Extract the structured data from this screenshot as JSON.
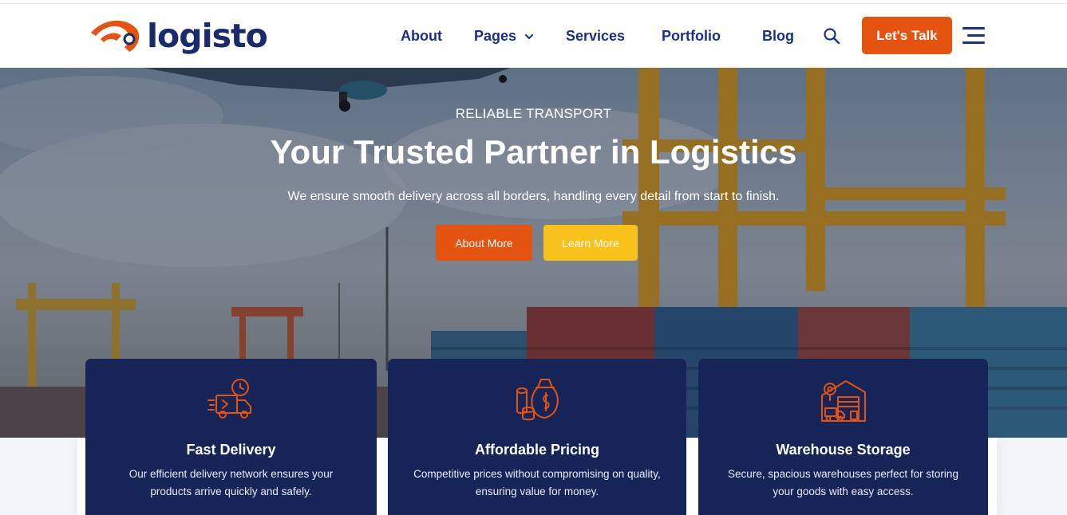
{
  "brand": {
    "name": "logisto",
    "logo_icon": "logo-mark-icon",
    "colors": {
      "primary": "#e4530f",
      "navy": "#172458",
      "nav_text": "#1b2f8a",
      "accent_yellow": "#f8c21b"
    }
  },
  "nav": {
    "items": [
      {
        "label": "About"
      },
      {
        "label": "Pages",
        "has_dropdown": true
      },
      {
        "label": "Services"
      },
      {
        "label": "Portfolio"
      },
      {
        "label": "Blog"
      }
    ],
    "search_icon": "search-icon",
    "cta_label": "Let's Talk",
    "menu_icon": "hamburger-menu-icon"
  },
  "hero": {
    "eyebrow": "RELIABLE TRANSPORT",
    "title": "Your Trusted Partner in Logistics",
    "subtitle": "We ensure smooth delivery across all borders, handling every detail from start to finish.",
    "primary_button": "About More",
    "secondary_button": "Learn More"
  },
  "features": [
    {
      "icon": "delivery-truck-icon",
      "title": "Fast Delivery",
      "description": "Our efficient delivery network ensures your products arrive quickly and safely."
    },
    {
      "icon": "money-bag-icon",
      "title": "Affordable Pricing",
      "description": "Competitive prices without compromising on quality, ensuring value for money."
    },
    {
      "icon": "warehouse-icon",
      "title": "Warehouse Storage",
      "description": "Secure, spacious warehouses perfect for storing your goods with easy access."
    }
  ]
}
